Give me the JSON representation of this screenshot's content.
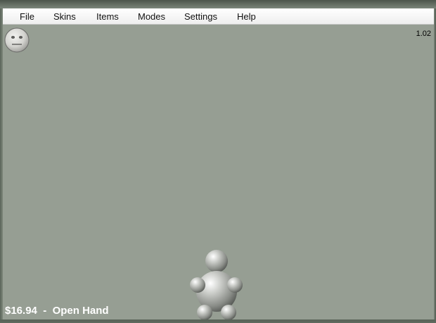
{
  "menu": {
    "items": [
      "File",
      "Skins",
      "Items",
      "Modes",
      "Settings",
      "Help"
    ]
  },
  "version": "1.02",
  "status": {
    "money": "$16.94",
    "separator": "  -  ",
    "item": "Open Hand"
  },
  "face_icon": "neutral-face-icon",
  "colors": {
    "viewport_bg": "#969e93",
    "menubar_bg": "#ffffff",
    "status_text": "#ffffff"
  }
}
